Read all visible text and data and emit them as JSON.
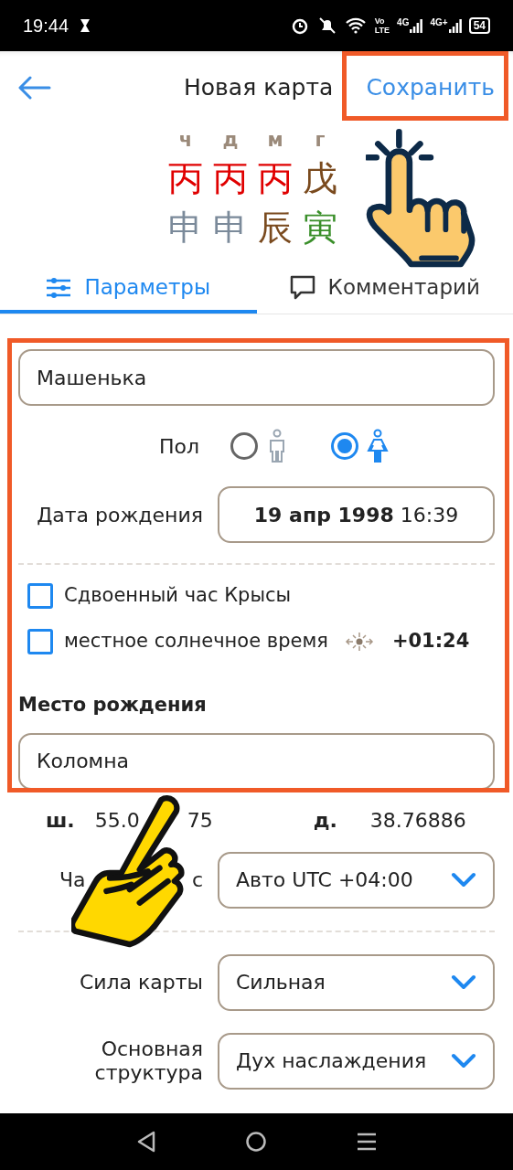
{
  "status_bar": {
    "time": "19:44",
    "volte": [
      "Vo",
      "LTE"
    ],
    "networks": [
      "4G",
      "4G+"
    ],
    "battery": "54"
  },
  "header": {
    "title": "Новая карта",
    "save": "Сохранить"
  },
  "pillars": {
    "labels": [
      "ч",
      "д",
      "м",
      "г"
    ],
    "stems": [
      {
        "char": "丙",
        "color": "#e00000"
      },
      {
        "char": "丙",
        "color": "#e00000"
      },
      {
        "char": "丙",
        "color": "#e00000"
      },
      {
        "char": "戊",
        "color": "#7a4a1e"
      }
    ],
    "branches": [
      {
        "char": "申",
        "color": "#7b8a9a"
      },
      {
        "char": "申",
        "color": "#7b8a9a"
      },
      {
        "char": "辰",
        "color": "#7a4a1e"
      },
      {
        "char": "寅",
        "color": "#3a8f2a"
      }
    ]
  },
  "tabs": [
    {
      "label": "Параметры",
      "kind": "settings",
      "selected": true
    },
    {
      "label": "Комментарий",
      "kind": "comment",
      "selected": false
    }
  ],
  "form": {
    "name": "Машенька",
    "gender_label": "Пол",
    "genders": [
      {
        "kind": "male",
        "selected": false
      },
      {
        "kind": "female",
        "selected": true
      }
    ],
    "birth_date_label": "Дата рождения",
    "birth_date": "19 апр 1998",
    "birth_time": "16:39",
    "checkboxes": [
      {
        "label": "Сдвоенный час Крысы",
        "checked": false
      },
      {
        "label": "местное солнечное время",
        "checked": false,
        "offset": "+01:24"
      }
    ],
    "place_label": "Место рождения",
    "place": "Коломна",
    "latitude_label": "ш.",
    "latitude": [
      "55.0",
      "75"
    ],
    "longitude_label": "д.",
    "longitude": "38.76886",
    "timezone_label": [
      "Ча",
      "с"
    ],
    "timezone": "Авто UTC +04:00",
    "selects": [
      {
        "label": "Сила карты",
        "value": "Сильная"
      },
      {
        "label": "Основная структура",
        "value": "Дух наслаждения"
      }
    ]
  }
}
